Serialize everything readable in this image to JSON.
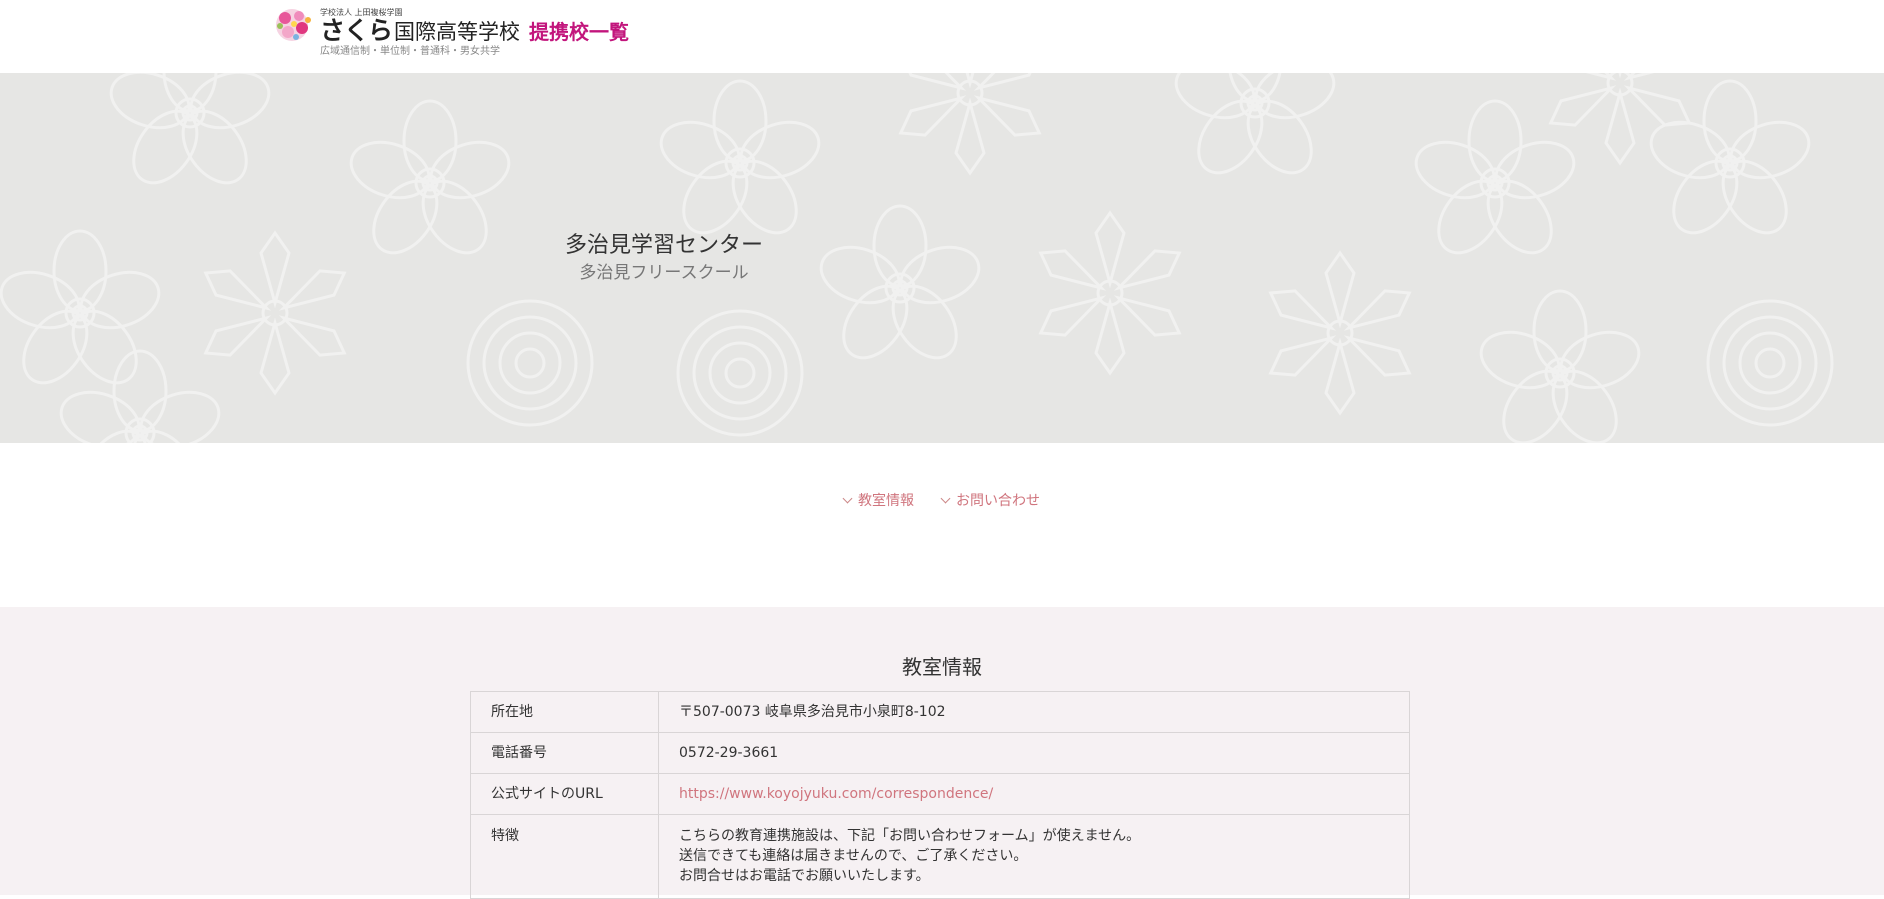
{
  "header": {
    "logo_small": "学校法人 上田複桜学園",
    "logo_sakura": "さくら",
    "logo_school": "国際高等学校",
    "partner_label": "提携校一覧",
    "logo_sub": "広域通信制・単位制・普通科・男女共学"
  },
  "hero": {
    "title": "多治見学習センター",
    "subtitle": "多治見フリースクール"
  },
  "anchor_nav": [
    {
      "label": "教室情報"
    },
    {
      "label": "お問い合わせ"
    }
  ],
  "info": {
    "title": "教室情報",
    "rows": [
      {
        "label": "所在地",
        "value": "〒507-0073 岐阜県多治見市小泉町8-102"
      },
      {
        "label": "電話番号",
        "value": "0572-29-3661"
      },
      {
        "label": "公式サイトのURL",
        "value": "https://www.koyojyuku.com/correspondence/"
      },
      {
        "label": "特徴",
        "lines": [
          "こちらの教育連携施設は、下記「お問い合わせフォーム」が使えません。",
          "送信できても連絡は届きませんので、ご了承ください。",
          "お問合せはお電話でお願いいたします。"
        ]
      }
    ]
  },
  "colors": {
    "accent_pink": "#c2157c",
    "link": "#d0757e",
    "hero_bg": "#e6e6e4",
    "info_bg": "#f6f1f3"
  }
}
